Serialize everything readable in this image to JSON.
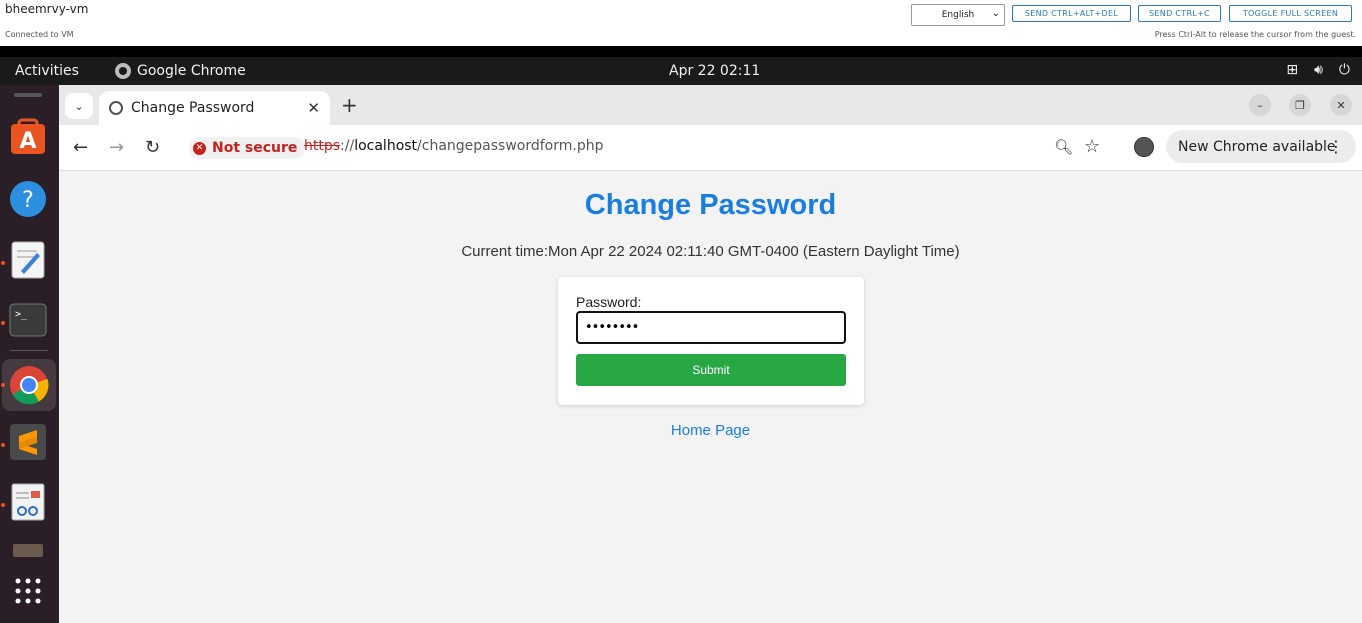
{
  "vm": {
    "name": "bheemrvy-vm",
    "status": "Connected to VM",
    "language": "English",
    "buttons": [
      "SEND CTRL+ALT+DEL",
      "SEND CTRL+C",
      "TOGGLE FULL SCREEN"
    ],
    "hint": "Press Ctrl-Alt to release the cursor from the guest."
  },
  "topbar": {
    "activities": "Activities",
    "app": "Google Chrome",
    "clock": "Apr 22  02:11"
  },
  "dock": {
    "items": [
      "ubuntu-software-icon",
      "help-icon",
      "text-editor-icon",
      "terminal-icon",
      "chrome-icon",
      "sublime-text-icon",
      "document-viewer-icon",
      "files-icon",
      "show-apps-icon"
    ]
  },
  "chrome": {
    "tab_title": "Change Password",
    "security": "Not secure",
    "url_scheme": "https",
    "url_sep": "://",
    "url_host": "localhost",
    "url_path": "/changepasswordform.php",
    "update_label": "New Chrome available"
  },
  "page": {
    "heading": "Change Password",
    "current_time": "Current time:Mon Apr 22 2024 02:11:40 GMT-0400 (Eastern Daylight Time)",
    "password_label": "Password:",
    "password_value": "••••••••",
    "submit_label": "Submit",
    "home_link": "Home Page"
  }
}
